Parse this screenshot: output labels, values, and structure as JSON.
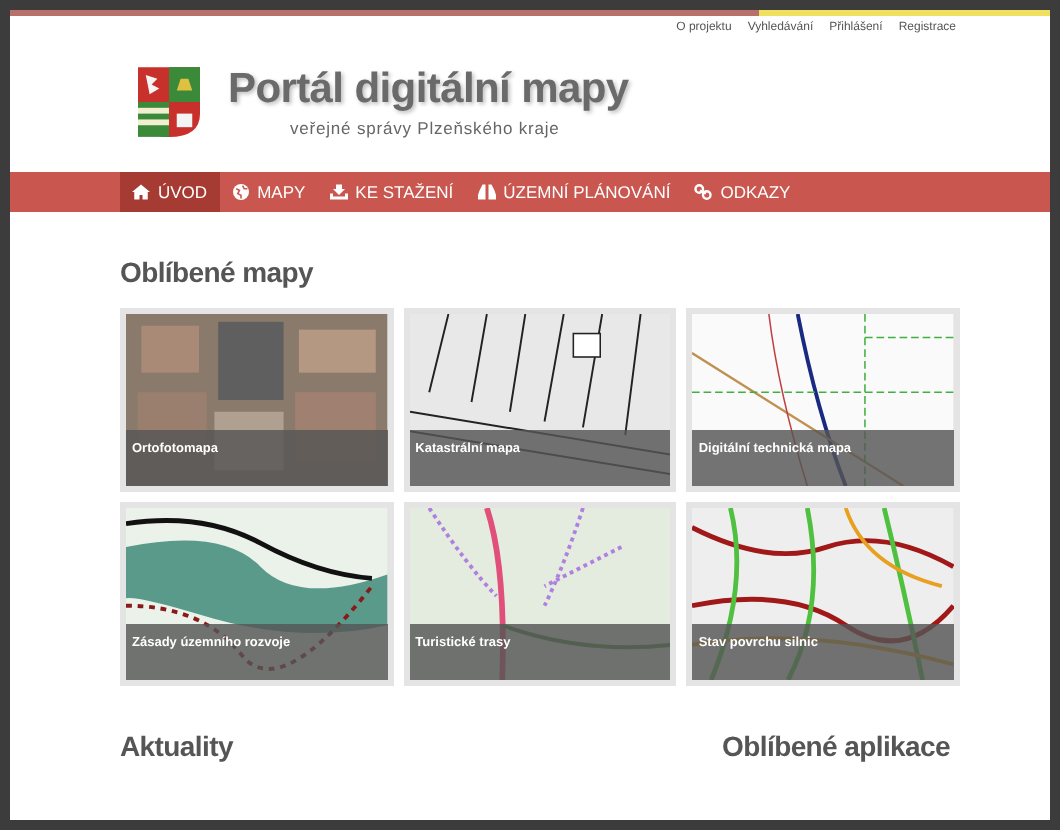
{
  "top_links": [
    "O projektu",
    "Vyhledávání",
    "Přihlášení",
    "Registrace"
  ],
  "header": {
    "title": "Portál digitální mapy",
    "subtitle": "veřejné správy Plzeňského kraje"
  },
  "nav": [
    {
      "label": "ÚVOD",
      "selected": true
    },
    {
      "label": "MAPY",
      "selected": false
    },
    {
      "label": "KE STAŽENÍ",
      "selected": false
    },
    {
      "label": "ÚZEMNÍ PLÁNOVÁNÍ",
      "selected": false
    },
    {
      "label": "ODKAZY",
      "selected": false
    }
  ],
  "favorite_maps": {
    "heading": "Oblíbené mapy",
    "tiles": [
      {
        "caption": "Ortofotomapa",
        "kind": "aerial"
      },
      {
        "caption": "Katastrální mapa",
        "kind": "cadastral"
      },
      {
        "caption": "Digitální technická mapa",
        "kind": "technical"
      },
      {
        "caption": "Zásady územního rozvoje",
        "kind": "zoning"
      },
      {
        "caption": "Turistické trasy",
        "kind": "hiking"
      },
      {
        "caption": "Stav povrchu silnic",
        "kind": "roads"
      }
    ]
  },
  "news": {
    "heading": "Aktuality"
  },
  "favorite_apps": {
    "heading": "Oblíbené aplikace"
  }
}
